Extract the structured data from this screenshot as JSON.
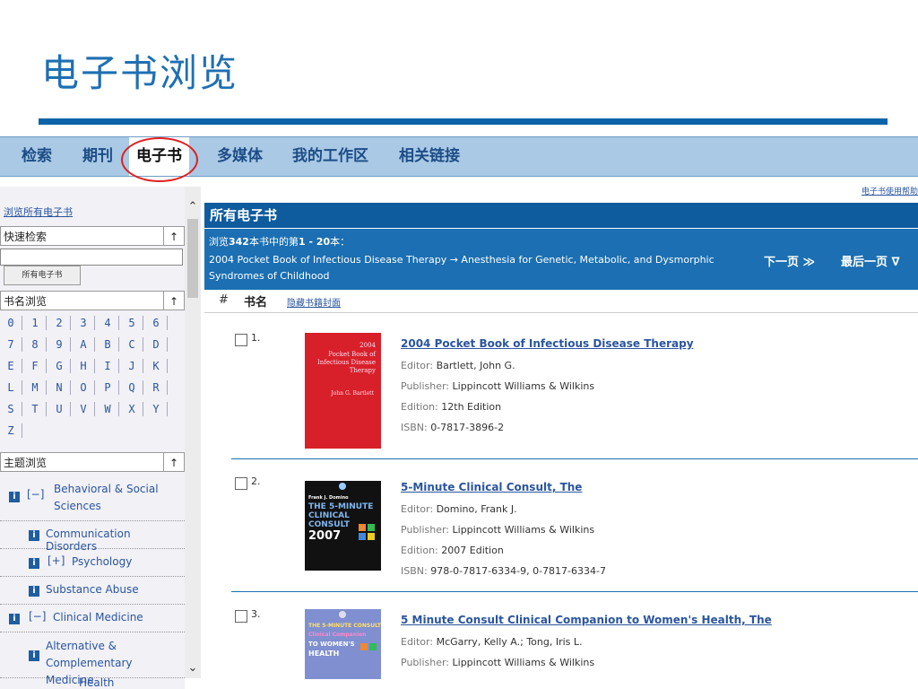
{
  "slide_title": "电子书浏览",
  "nav": {
    "tabs": [
      {
        "label": "检索"
      },
      {
        "label": "期刊"
      },
      {
        "label": "电子书"
      },
      {
        "label": "多媒体"
      },
      {
        "label": "我的工作区"
      },
      {
        "label": "相关链接"
      }
    ],
    "active_index": 2,
    "accent_color": "#e02020"
  },
  "sidebar": {
    "browse_all_link": "浏览所有电子书",
    "quick_search": {
      "header": "快速检索",
      "input_value": "",
      "button_label": "所有电子书"
    },
    "title_browse": {
      "header": "书名浏览",
      "letters": [
        "0",
        "1",
        "2",
        "3",
        "4",
        "5",
        "6",
        "7",
        "8",
        "9",
        "A",
        "B",
        "C",
        "D",
        "E",
        "F",
        "G",
        "H",
        "I",
        "J",
        "K",
        "L",
        "M",
        "N",
        "O",
        "P",
        "Q",
        "R",
        "S",
        "T",
        "U",
        "V",
        "W",
        "X",
        "Y",
        "Z"
      ]
    },
    "subject_browse": {
      "header": "主题浏览",
      "items": [
        {
          "toggle": "[−]",
          "label": "Behavioral & Social Sciences"
        },
        {
          "toggle": "",
          "label": "Communication Disorders"
        },
        {
          "toggle": "[+]",
          "label": "Psychology"
        },
        {
          "toggle": "",
          "label": "Substance Abuse"
        },
        {
          "toggle": "[−]",
          "label": "Clinical Medicine"
        },
        {
          "toggle": "",
          "label": "Alternative & Complementary Medicine"
        }
      ],
      "cut_off_text": "Health"
    },
    "sort_arrow": "↑",
    "info_icon": "i"
  },
  "main": {
    "top_link": "电子书使用帮助",
    "header": "所有电子书",
    "info_line1_prefix": "浏览",
    "info_total": "342",
    "info_line1_middle": "本书中的第",
    "info_range": "1 - 20",
    "info_line1_suffix": "本：",
    "info_line2": "2004 Pocket Book of Infectious Disease Therapy → Anesthesia for Genetic, Metabolic, and Dysmorphic Syndromes of Childhood",
    "next_page": "下一页 ≫",
    "last_page": "最后一页 ∇",
    "col_hash": "#",
    "col_title": "书名",
    "hide_covers": "隐藏书籍封面",
    "labels": {
      "editor": "Editor:",
      "publisher": "Publisher:",
      "edition": "Edition:",
      "isbn": "ISBN:"
    },
    "books": [
      {
        "num": "1.",
        "title": "2004 Pocket Book of Infectious Disease Therapy",
        "editor": "Bartlett, John G.",
        "publisher": "Lippincott Williams & Wilkins",
        "edition": "12th Edition",
        "isbn": "0-7817-3896-2",
        "cover": {
          "bg": "#d8202a",
          "line1": "2004",
          "line2": "Pocket Book of",
          "line3": "Infectious Disease",
          "line4": "Therapy",
          "author": "John G. Bartlett"
        }
      },
      {
        "num": "2.",
        "title": "5-Minute Clinical Consult, The",
        "editor": "Domino, Frank J.",
        "publisher": "Lippincott Williams & Wilkins",
        "edition": "2007 Edition",
        "isbn": "978-0-7817-6334-9, 0-7817-6334-7",
        "cover": {
          "bg": "#111111",
          "author": "Frank J. Domino",
          "line1": "THE 5-MINUTE",
          "line2": "CLINICAL",
          "line3": "CONSULT",
          "line4": "2007"
        }
      },
      {
        "num": "3.",
        "title": "5 Minute Consult Clinical Companion to Women's Health, The",
        "editor": "McGarry, Kelly A.; Tong, Iris L.",
        "publisher": "Lippincott Williams & Wilkins",
        "cover": {
          "bg": "#7f8fd0",
          "line1": "THE 5-MINUTE CONSULT",
          "line2": "Clinical Companion",
          "line3": "TO WOMEN'S",
          "line4": "HEALTH"
        }
      }
    ]
  }
}
